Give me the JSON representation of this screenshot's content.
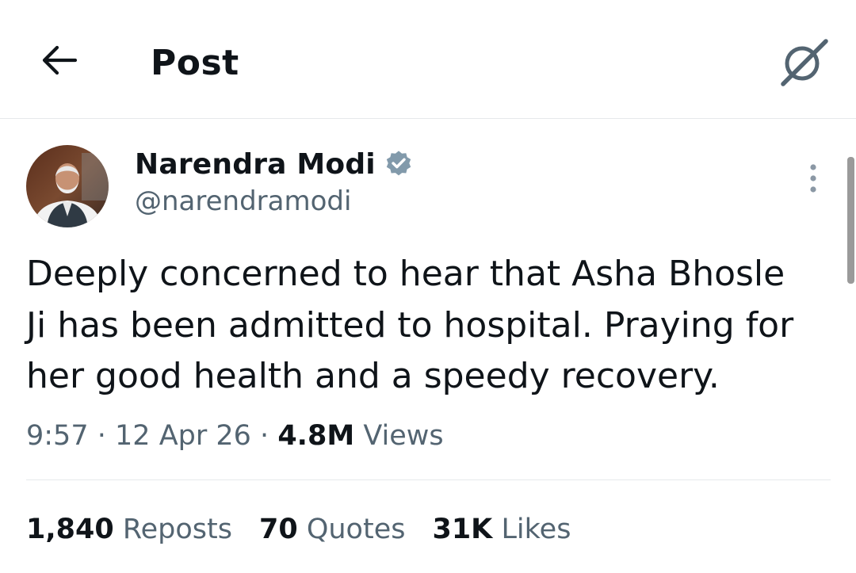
{
  "header": {
    "title": "Post",
    "back_icon": "arrow-left-icon",
    "grok_icon": "grok-icon"
  },
  "author": {
    "name": "Narendra Modi",
    "handle": "@narendramodi",
    "verified": true,
    "verified_color": "#829aab"
  },
  "post": {
    "text_lines": [
      "Deeply concerned to hear that Asha Bhosle",
      "Ji has been admitted to hospital. Praying for",
      "her good health and a speedy recovery."
    ],
    "time": "9:57",
    "date": "12 Apr 26",
    "views_count": "4.8M",
    "views_label": "Views",
    "separator": "·"
  },
  "stats": {
    "reposts_count": "1,840",
    "reposts_label": "Reposts",
    "quotes_count": "70",
    "quotes_label": "Quotes",
    "likes_count": "31K",
    "likes_label": "Likes"
  },
  "colors": {
    "text_primary": "#0f1419",
    "text_secondary": "#536471",
    "divider": "#e6e9eb"
  }
}
